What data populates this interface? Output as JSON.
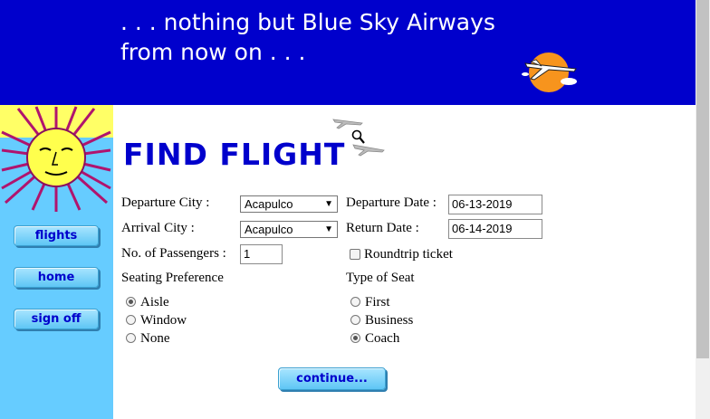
{
  "header": {
    "tagline": ". . . nothing but Blue Sky Airways\nfrom now on . . ."
  },
  "nav": {
    "flights": "flights",
    "home": "home",
    "sign_off": "sign off"
  },
  "page": {
    "title": "FIND FLIGHT"
  },
  "form": {
    "departure_city": {
      "label": "Departure City :",
      "value": "Acapulco"
    },
    "arrival_city": {
      "label": "Arrival City :",
      "value": "Acapulco"
    },
    "passengers": {
      "label": "No. of Passengers :",
      "value": "1"
    },
    "departure_date": {
      "label": "Departure Date :",
      "value": "06-13-2019"
    },
    "return_date": {
      "label": "Return Date :",
      "value": "06-14-2019"
    },
    "roundtrip": {
      "label": "Roundtrip ticket",
      "checked": false
    },
    "seating": {
      "label": "Seating Preference",
      "options": [
        "Aisle",
        "Window",
        "None"
      ],
      "selected": "Aisle"
    },
    "seat_type": {
      "label": "Type of Seat",
      "options": [
        "First",
        "Business",
        "Coach"
      ],
      "selected": "Coach"
    },
    "continue_label": "continue..."
  },
  "colors": {
    "banner": "#0000cc",
    "sidebar": "#66ccff",
    "title": "#0000cc"
  },
  "icons": [
    "sun-icon",
    "airline-logo-icon",
    "plane-icon",
    "magnifier-cursor-icon",
    "dropdown-arrow-icon"
  ]
}
